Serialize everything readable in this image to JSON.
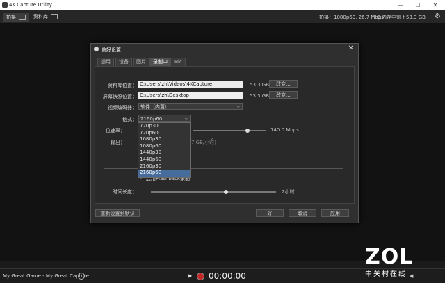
{
  "window": {
    "title": "4K Capture Utility",
    "minimize": "—",
    "maximize": "☐",
    "close": "✕"
  },
  "toolbar": {
    "tabs": [
      {
        "label": "拍摄"
      },
      {
        "label": "资料库"
      }
    ],
    "status_capture": "拍摄：1080p60, 26.7 Mbps",
    "status_disk": "C:内存中剩下53.3 GB"
  },
  "dialog": {
    "title": "偏好设置",
    "tabs": [
      {
        "label": "通用"
      },
      {
        "label": "设备"
      },
      {
        "label": "图片"
      },
      {
        "label": "录制中"
      },
      {
        "label": "Mic"
      }
    ],
    "library_label": "资料库位置：",
    "library_path": "C:\\Users\\zh\\Videos\\4KCapture",
    "library_size": "53.3 GB",
    "library_change": "改变...",
    "screenshot_label": "屏幕快照位置：",
    "screenshot_path": "C:\\Users\\zh\\Desktop",
    "screenshot_size": "53.3 GB",
    "screenshot_change": "改变...",
    "encoder_label": "视频编码器：",
    "encoder_value": "软件（内置）",
    "format_label": "格式：",
    "format_value": "2160p60",
    "bitrate_label": "位速率：",
    "bitrate_value": "140.0 Mbps",
    "bitrate_fraction": 0.75,
    "output_label": "输出：",
    "output_partial": "7 GB/小时)",
    "flashback_label": "启用Flashback录制",
    "duration_label": "时间长度：",
    "duration_value": "2小时",
    "duration_fraction": 0.6,
    "reset_button": "重新设置到默认",
    "ok_button": "好",
    "cancel_button": "取消",
    "apply_button": "应用"
  },
  "dropdown": {
    "options": [
      "720p30",
      "720p60",
      "1080p30",
      "1080p60",
      "1440p30",
      "1440p60",
      "2160p30",
      "2160p60"
    ],
    "selected_index": 7
  },
  "bottombar": {
    "game": "My Great Game - My Great Capture",
    "timer": "00:00:00"
  },
  "brand": {
    "main": "ZOL",
    "sub": "中关村在线"
  },
  "colors": {
    "accent": "#456c9a",
    "record": "#c62828"
  }
}
